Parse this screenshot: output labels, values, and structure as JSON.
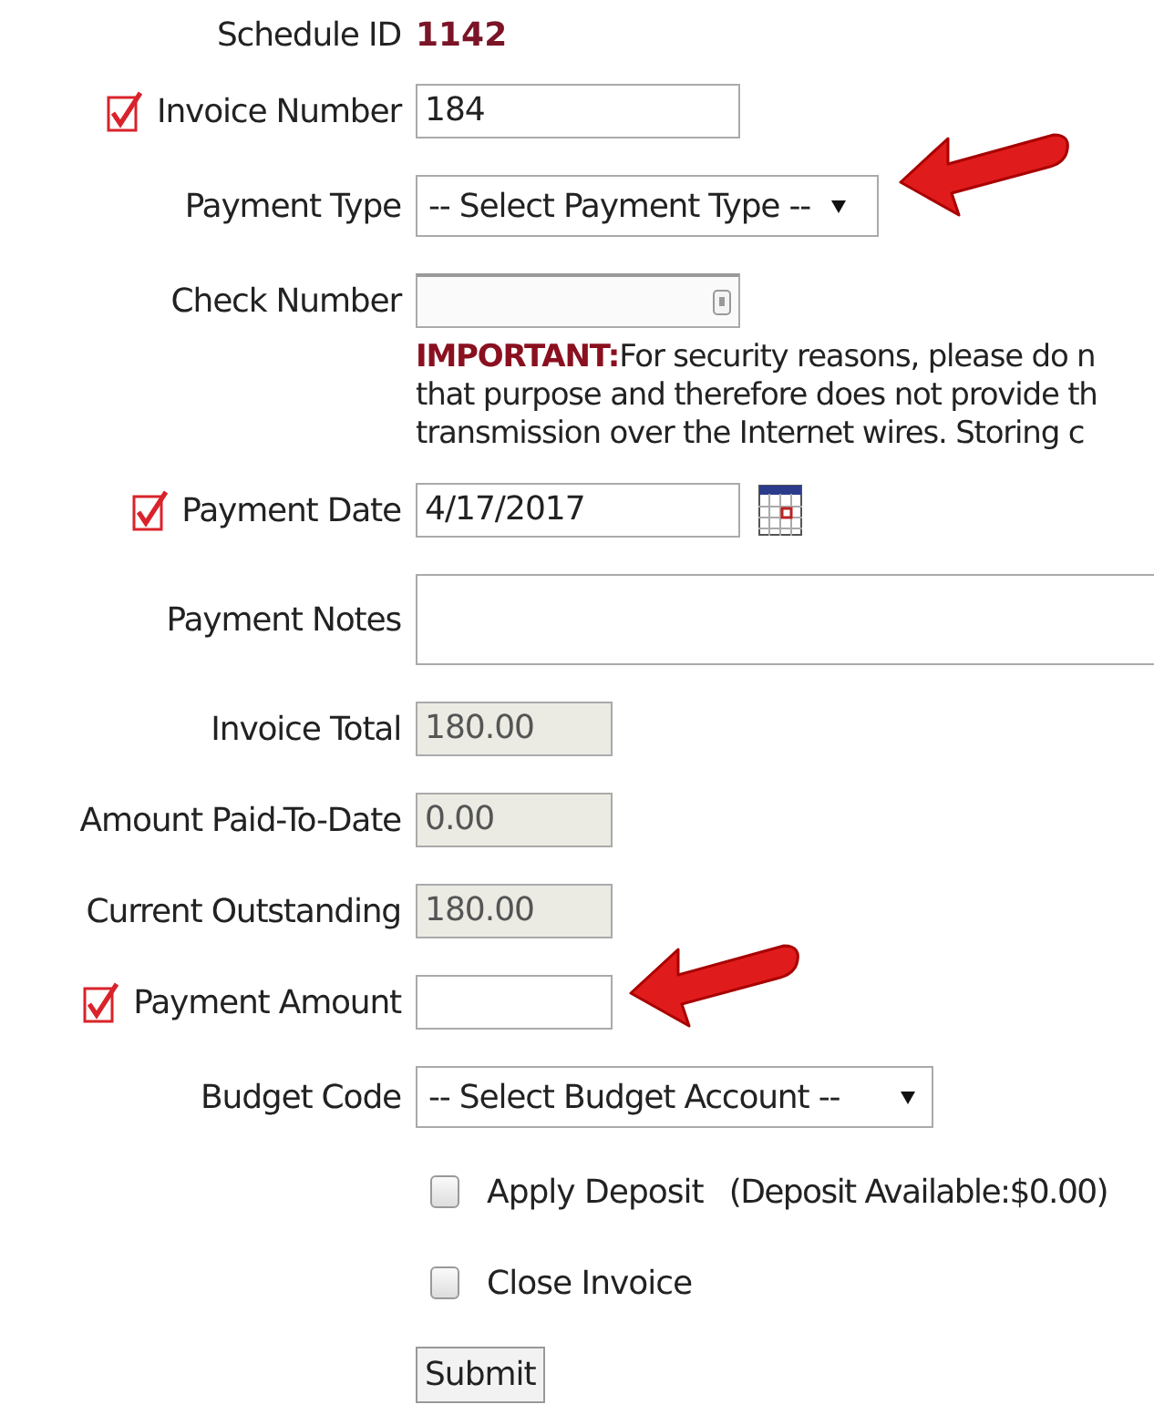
{
  "schedule": {
    "label": "Schedule ID",
    "value": "1142"
  },
  "fields": [
    {
      "kind": "text",
      "label": "Invoice Number",
      "required": true,
      "pointer": false,
      "value": "184"
    },
    {
      "kind": "select",
      "label": "Payment Type",
      "required": false,
      "pointer": true,
      "value": "-- Select Payment Type --"
    },
    {
      "kind": "masked",
      "label": "Check Number",
      "required": false,
      "pointer": false
    },
    {
      "kind": "notice",
      "lines": [
        "**IMPORTANT:**For security reasons, please do n",
        "that purpose and therefore does not provide th",
        "transmission over the Internet wires. Storing c"
      ]
    },
    {
      "kind": "date",
      "label": "Payment Date",
      "required": true,
      "pointer": false,
      "value": "4/17/2017"
    },
    {
      "kind": "textarea",
      "label": "Payment Notes",
      "required": false,
      "pointer": false
    },
    {
      "kind": "readonly",
      "label": "Invoice Total",
      "required": false,
      "pointer": false,
      "value": "180.00"
    },
    {
      "kind": "readonly",
      "label": "Amount Paid-To-Date",
      "required": false,
      "pointer": false,
      "value": "0.00"
    },
    {
      "kind": "readonly",
      "label": "Current Outstanding",
      "required": false,
      "pointer": false,
      "value": "180.00"
    },
    {
      "kind": "text",
      "label": "Payment Amount",
      "required": true,
      "pointer": true
    },
    {
      "kind": "select",
      "label": "Budget Code",
      "required": false,
      "pointer": false,
      "value": "-- Select Budget Account --",
      "wide": true
    }
  ],
  "options": [
    {
      "label": "Apply Deposit",
      "checked": false,
      "note": "(Deposit Available:$0.00)"
    },
    {
      "label": "Close Invoice",
      "checked": false
    }
  ],
  "submit": "Submit"
}
